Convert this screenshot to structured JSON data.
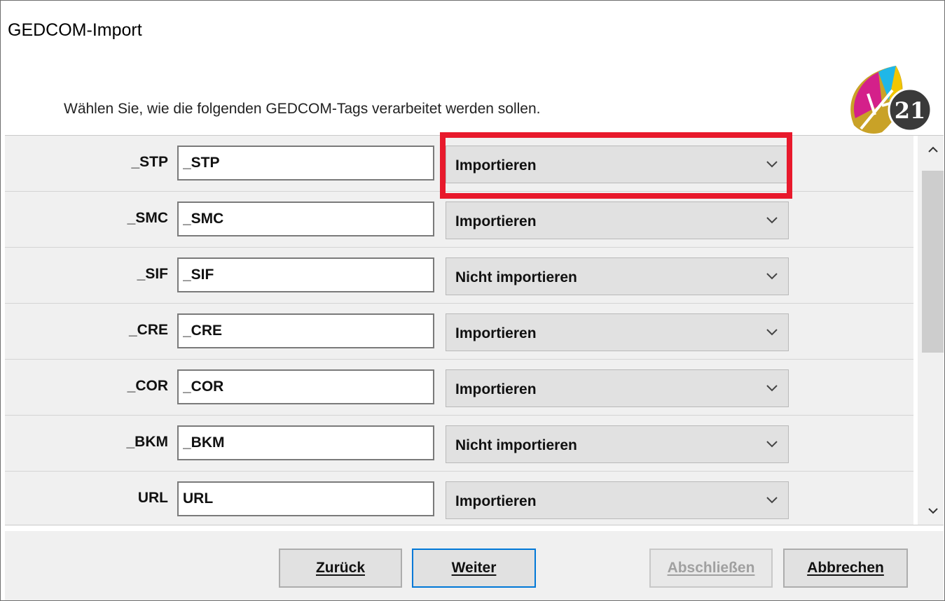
{
  "window": {
    "title": "GEDCOM-Import"
  },
  "instruction": "Wählen Sie, wie die folgenden GEDCOM-Tags verarbeitet werden sollen.",
  "logo": {
    "icon": "ahnenblatt-21-logo-icon",
    "label": "21"
  },
  "rows": [
    {
      "label": "_STP",
      "value": "_STP",
      "option": "Importieren"
    },
    {
      "label": "_SMC",
      "value": "_SMC",
      "option": "Importieren"
    },
    {
      "label": "_SIF",
      "value": "_SIF",
      "option": "Nicht importieren"
    },
    {
      "label": "_CRE",
      "value": "_CRE",
      "option": "Importieren"
    },
    {
      "label": "_COR",
      "value": "_COR",
      "option": "Importieren"
    },
    {
      "label": "_BKM",
      "value": "_BKM",
      "option": "Nicht importieren"
    },
    {
      "label": "URL",
      "value": "URL",
      "option": "Importieren"
    }
  ],
  "highlight_color": "#e8192c",
  "buttons": {
    "back": "Zurück",
    "next": "Weiter",
    "finish": "Abschließen",
    "cancel": "Abbrechen"
  },
  "colors": {
    "focus_border": "#0078d7",
    "disabled_text": "#a0a0a0"
  }
}
